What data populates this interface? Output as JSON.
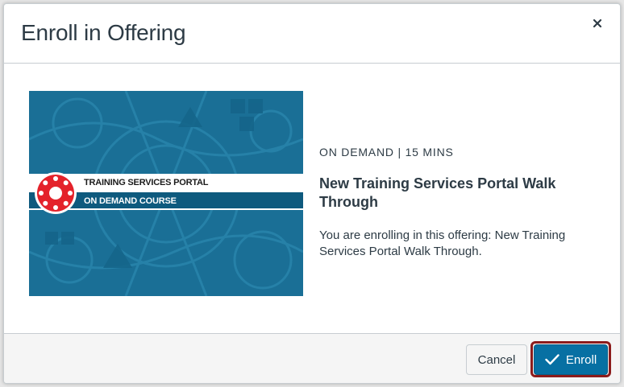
{
  "modal": {
    "title": "Enroll in Offering",
    "close_label": "×"
  },
  "thumbnail": {
    "title": "TRAINING SERVICES PORTAL",
    "subtitle": "ON DEMAND COURSE",
    "logo_icon": "canvas-logo-icon",
    "colors": {
      "background": "#1a6f96",
      "logo": "#e4222b"
    }
  },
  "offering": {
    "meta": "ON DEMAND | 15 MINS",
    "title": "New Training Services Portal Walk Through",
    "description": "You are enrolling in this offering: New Training Services Portal Walk Through."
  },
  "footer": {
    "cancel_label": "Cancel",
    "enroll_label": "Enroll",
    "enroll_icon": "check-icon",
    "colors": {
      "primary": "#0770a3",
      "highlight": "#8c1c1c"
    }
  }
}
